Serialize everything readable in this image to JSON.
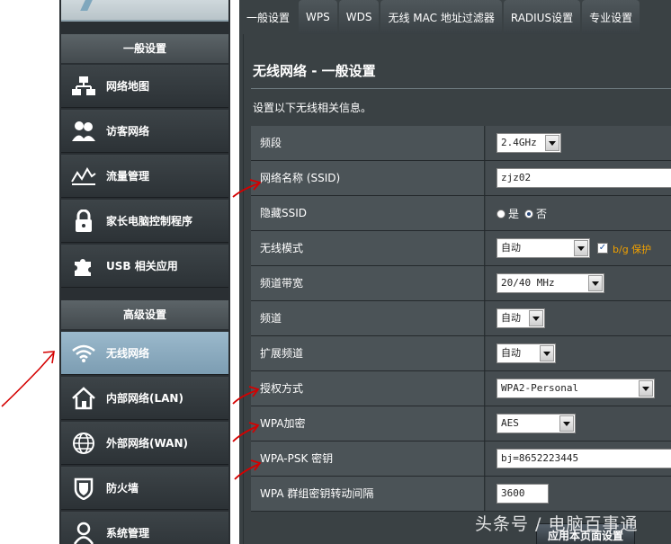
{
  "sidebar": {
    "section_general": "一般设置",
    "section_advanced": "高级设置",
    "general_items": [
      {
        "label": "网络地图",
        "icon": "network-map-icon"
      },
      {
        "label": "访客网络",
        "icon": "guest-network-icon"
      },
      {
        "label": "流量管理",
        "icon": "traffic-manager-icon"
      },
      {
        "label": "家长电脑控制程序",
        "icon": "parental-control-lock-icon"
      },
      {
        "label": "USB 相关应用",
        "icon": "usb-puzzle-icon"
      }
    ],
    "advanced_items": [
      {
        "label": "无线网络",
        "icon": "wifi-icon",
        "active": true
      },
      {
        "label": "内部网络(LAN)",
        "icon": "home-icon"
      },
      {
        "label": "外部网络(WAN)",
        "icon": "globe-icon"
      },
      {
        "label": "防火墙",
        "icon": "shield-icon"
      },
      {
        "label": "系统管理",
        "icon": "user-admin-icon"
      }
    ]
  },
  "tabs": [
    "一般设置",
    "WPS",
    "WDS",
    "无线 MAC 地址过滤器",
    "RADIUS设置",
    "专业设置"
  ],
  "page": {
    "title": "无线网络 - 一般设置",
    "description": "设置以下无线相关信息。"
  },
  "settings": {
    "band": {
      "label": "频段",
      "value": "2.4GHz"
    },
    "ssid": {
      "label": "网络名称 (SSID)",
      "value": "zjz02"
    },
    "hide_ssid": {
      "label": "隐藏SSID",
      "option_yes": "是",
      "option_no": "否",
      "selected": "否"
    },
    "wireless_mode": {
      "label": "无线模式",
      "value": "自动",
      "bg_protection_label": "b/g 保护",
      "bg_protection_checked": true
    },
    "channel_bandwidth": {
      "label": "频道带宽",
      "value": "20/40 MHz"
    },
    "channel": {
      "label": "频道",
      "value": "自动"
    },
    "extension_channel": {
      "label": "扩展频道",
      "value": "自动"
    },
    "auth_method": {
      "label": "授权方式",
      "value": "WPA2-Personal"
    },
    "wpa_encryption": {
      "label": "WPA加密",
      "value": "AES"
    },
    "wpa_psk": {
      "label": "WPA-PSK 密钥",
      "value": "bj=8652223445"
    },
    "group_key_interval": {
      "label": "WPA 群组密钥转动间隔",
      "value": "3600"
    }
  },
  "apply_label": "应用本页面设置",
  "watermark": "头条号 / 电脑百事通",
  "colors": {
    "sidebar_bg": "#2a2f33",
    "active_item": "#8eacbf",
    "panel_bg": "#3a4144",
    "annotation_red": "#d40000",
    "check_label": "#f0a000"
  }
}
